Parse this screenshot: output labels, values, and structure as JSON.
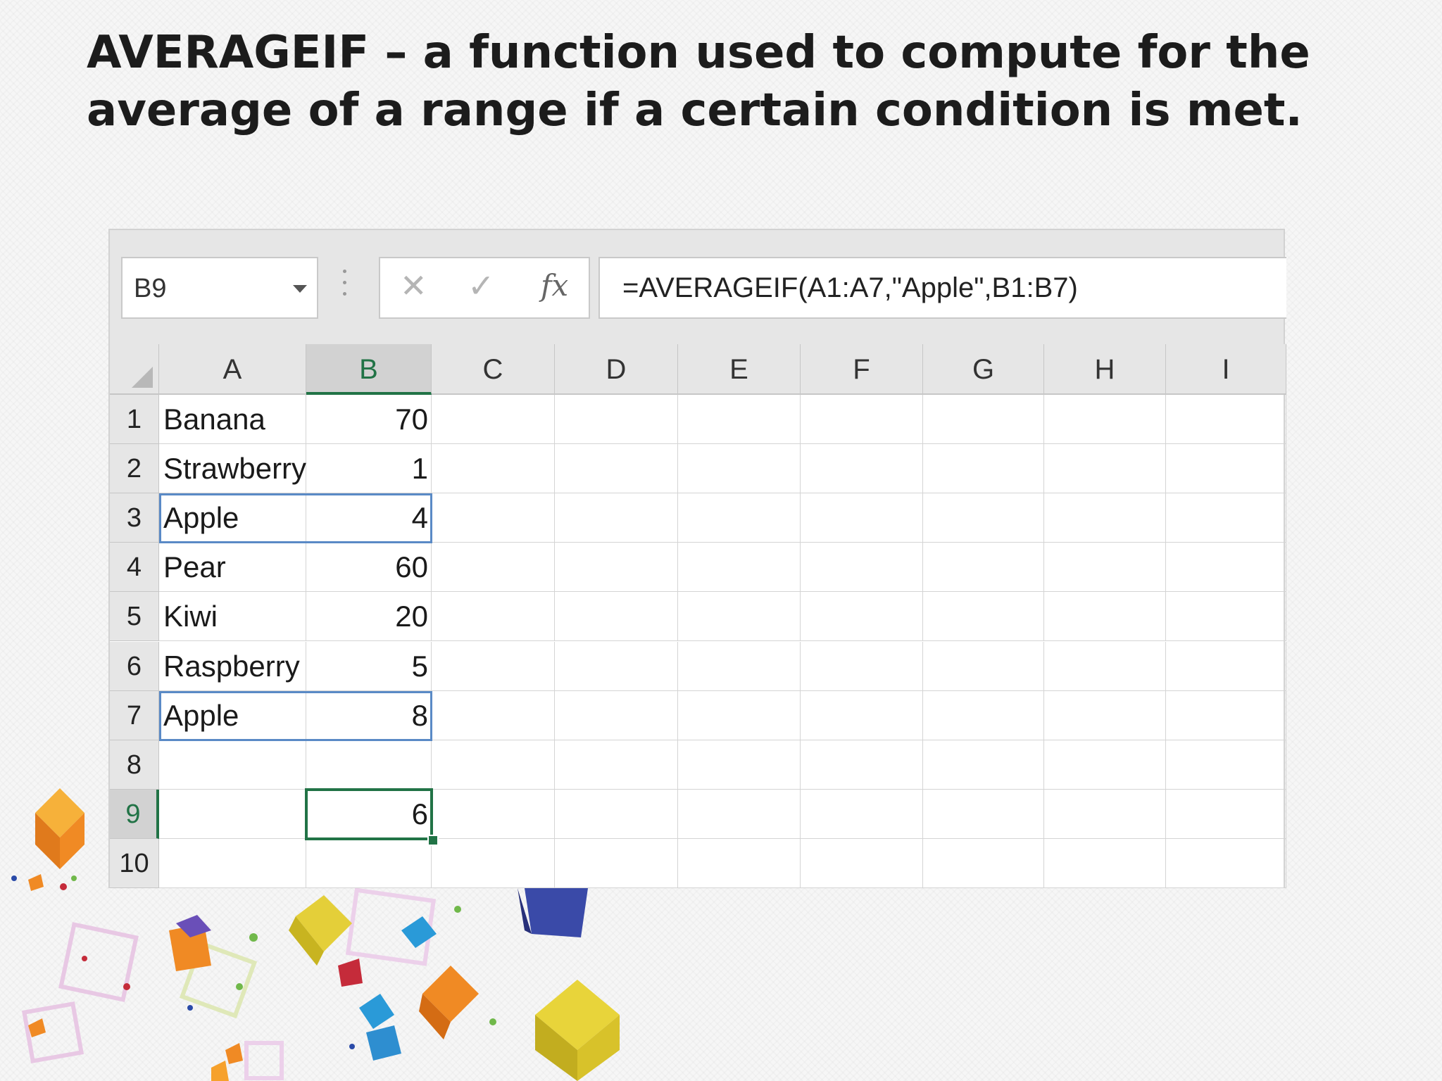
{
  "slide": {
    "title_line1": "AVERAGEIF – a function used to compute for the",
    "title_line2": "average of a range if a certain condition is met."
  },
  "formula_bar": {
    "name_box": "B9",
    "cancel_icon": "✕",
    "enter_icon": "✓",
    "fx_label": "fx",
    "formula": "=AVERAGEIF(A1:A7,\"Apple\",B1:B7)"
  },
  "sheet": {
    "columns": [
      "A",
      "B",
      "C",
      "D",
      "E",
      "F",
      "G",
      "H",
      "I"
    ],
    "active_column": "B",
    "active_row": 9,
    "rows": [
      {
        "num": "1",
        "a": "Banana",
        "b": "70"
      },
      {
        "num": "2",
        "a": "Strawberry",
        "b": "1"
      },
      {
        "num": "3",
        "a": "Apple",
        "b": "4"
      },
      {
        "num": "4",
        "a": "Pear",
        "b": "60"
      },
      {
        "num": "5",
        "a": "Kiwi",
        "b": "20"
      },
      {
        "num": "6",
        "a": "Raspberry",
        "b": "5"
      },
      {
        "num": "7",
        "a": "Apple",
        "b": "8"
      },
      {
        "num": "8",
        "a": "",
        "b": ""
      },
      {
        "num": "9",
        "a": "",
        "b": "6"
      },
      {
        "num": "10",
        "a": "",
        "b": ""
      }
    ],
    "highlighted_rows": [
      3,
      7
    ],
    "selected_cell": "B9"
  },
  "colors": {
    "excel_green": "#217346",
    "range_blue": "#5a8ac6",
    "header_gray": "#e6e6e6"
  }
}
